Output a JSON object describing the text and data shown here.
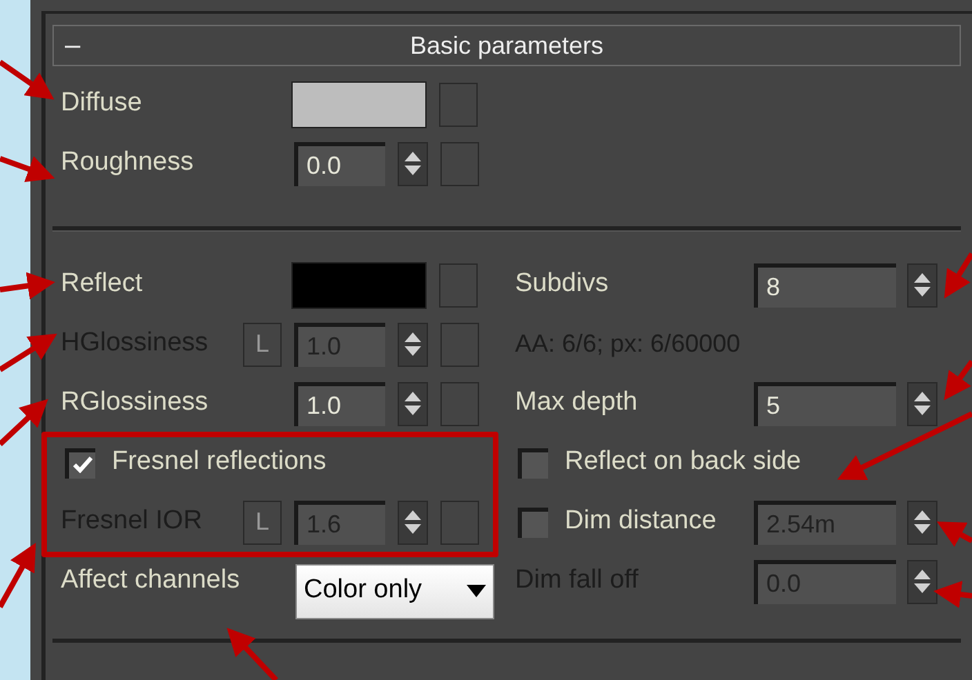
{
  "rollout": {
    "title": "Basic parameters",
    "collapse_symbol": "–"
  },
  "diffuse_section": [
    {
      "kind": "color",
      "label": "Diffuse",
      "color": "#bdbdbd"
    },
    {
      "kind": "spinner",
      "label": "Roughness",
      "value": "0.0",
      "disabled": false
    }
  ],
  "reflect_left": [
    {
      "kind": "color",
      "label": "Reflect",
      "color": "#000000"
    },
    {
      "kind": "spinner",
      "label": "HGlossiness",
      "lock": "L",
      "value": "1.0",
      "disabled": true
    },
    {
      "kind": "spinner",
      "label": "RGlossiness",
      "value": "1.0",
      "disabled": false
    },
    {
      "kind": "checkbox",
      "label": "Fresnel reflections",
      "checked": true
    },
    {
      "kind": "spinner",
      "label": "Fresnel IOR",
      "lock": "L",
      "value": "1.6",
      "disabled": true
    },
    {
      "kind": "dropdown",
      "label": "Affect channels",
      "value": "Color only"
    }
  ],
  "reflect_right": [
    {
      "kind": "spinner",
      "label": "Subdivs",
      "value": "8",
      "disabled": false
    },
    {
      "kind": "info",
      "label": "AA: 6/6; px: 6/60000",
      "disabled": true
    },
    {
      "kind": "spinner",
      "label": "Max depth",
      "value": "5",
      "disabled": false
    },
    {
      "kind": "checkbox",
      "label": "Reflect on back side",
      "checked": false
    },
    {
      "kind": "checkspinner",
      "label": "Dim distance",
      "checked": false,
      "value": "2.54m",
      "disabled": true
    },
    {
      "kind": "spinner",
      "label": "Dim fall off",
      "value": "0.0",
      "disabled": true
    }
  ]
}
